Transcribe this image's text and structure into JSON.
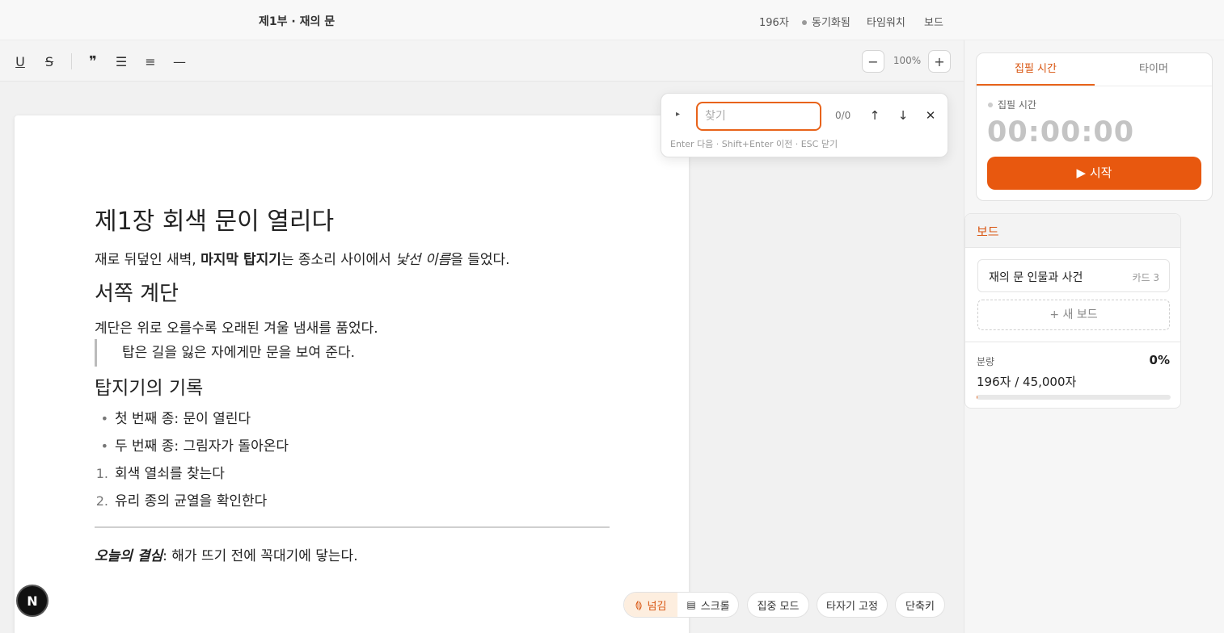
{
  "header": {
    "doc_title": "제1부 · 재의 문",
    "char_count": "196자",
    "sync_status": "동기화됨",
    "typewatch": "타임워치",
    "board": "보드"
  },
  "toolbar": {
    "underline": "U",
    "strike": "S",
    "quote": "❞",
    "bullet_list": "☰",
    "ordered_list": "≡",
    "divider": "—",
    "zoom_out": "−",
    "zoom": "100%",
    "zoom_in": "+"
  },
  "document": {
    "h1": "제1장 회색 문이 열리다",
    "p1": {
      "a": "재로 뒤덮인 새벽, ",
      "b": "마지막 탑지기",
      "c": "는 종소리 사이에서 ",
      "d": "낯선 이름",
      "e": "을 들었다."
    },
    "h2": "서쪽 계단",
    "p2": "계단은 위로 오를수록 오래된 겨울 냄새를 품었다.",
    "quote": "탑은 길을 잃은 자에게만 문을 보여 준다.",
    "h3": "탑지기의 기록",
    "bullets": [
      "첫 번째 종: 문이 열린다",
      "두 번째 종: 그림자가 돌아온다"
    ],
    "ordered": [
      "회색 열쇠를 찾는다",
      "유리 종의 균열을 확인한다"
    ],
    "ordered_marks": [
      "1.",
      "2."
    ],
    "bullet_mark": "•",
    "final": {
      "a": "오늘의 결심",
      "b": ": 해가 뜨기 전에 꼭대기에 닿는다."
    }
  },
  "find": {
    "toggle": "▸",
    "placeholder": "찾기",
    "count": "0/0",
    "prev": "↑",
    "next": "↓",
    "close": "✕",
    "hint": "Enter 다음 · Shift+Enter 이전 · ESC 닫기"
  },
  "timer": {
    "tab_writing": "집필 시간",
    "tab_timer": "타이머",
    "label": "집필 시간",
    "value": "00:00:00",
    "start": "▶ 시작"
  },
  "board_panel": {
    "title": "보드",
    "item_name": "재의 문 인물과 사건",
    "item_count": "카드 3",
    "add": "+ 새 보드",
    "volume_label": "분량",
    "volume_pct": "0%",
    "volume_value": "196자 / 45,000자",
    "volume_progress": 0.004
  },
  "bottom": {
    "flip": "넘김",
    "scroll": "스크롤",
    "focus": "집중 모드",
    "typewriter": "타자기 고정",
    "shortcuts": "단축키",
    "badge": "N"
  },
  "colors": {
    "accent": "#e8631a",
    "accent_dark": "#d8540f"
  }
}
